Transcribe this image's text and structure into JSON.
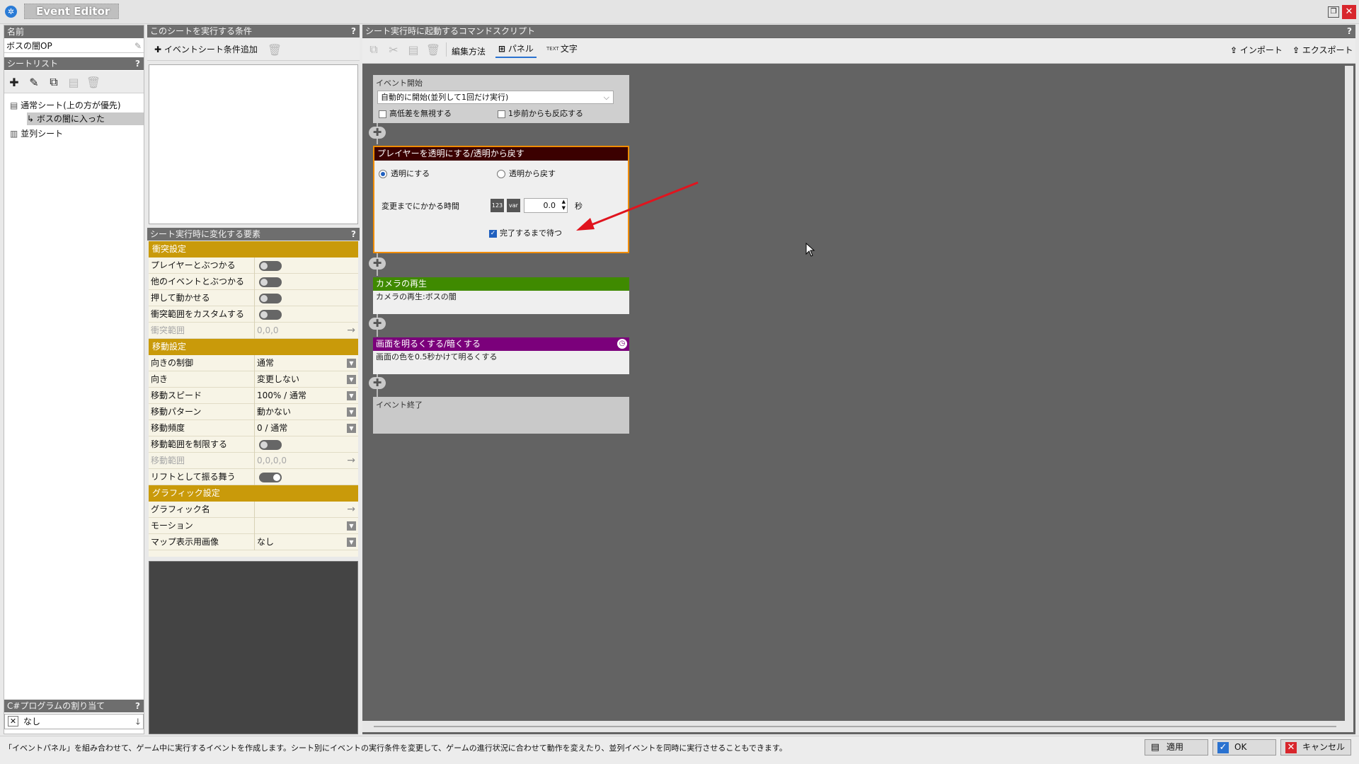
{
  "window": {
    "title": "Event Editor"
  },
  "left": {
    "name_header": "名前",
    "name_value": "ボスの闇OP",
    "sheet_header": "シートリスト",
    "tree": {
      "normal": "通常シート(上の方が優先)",
      "child": "ボスの闇に入った",
      "parallel": "並列シート"
    },
    "csharp_header": "C#プログラムの割り当て",
    "csharp_value": "なし"
  },
  "conditions": {
    "header": "このシートを実行する条件",
    "add_label": "イベントシート条件追加"
  },
  "props": {
    "header": "シート実行時に変化する要素",
    "cat1": "衝突設定",
    "r1": "プレイヤーとぶつかる",
    "r2": "他のイベントとぶつかる",
    "r3": "押して動かせる",
    "r4": "衝突範囲をカスタムする",
    "r5": "衝突範囲",
    "r5v": "0,0,0",
    "cat2": "移動設定",
    "r6": "向きの制御",
    "r6v": "通常",
    "r7": "向き",
    "r7v": "変更しない",
    "r8": "移動スピード",
    "r8v": "100% / 通常",
    "r9": "移動パターン",
    "r9v": "動かない",
    "r10": "移動頻度",
    "r10v": "0 / 通常",
    "r11": "移動範囲を制限する",
    "r12": "移動範囲",
    "r12v": "0,0,0,0",
    "r13": "リフトとして振る舞う",
    "cat3": "グラフィック設定",
    "r14": "グラフィック名",
    "r15": "モーション",
    "r16": "マップ表示用画像",
    "r16v": "なし"
  },
  "script": {
    "header": "シート実行時に起動するコマンドスクリプト",
    "edit_mode": "編集方法",
    "panel_mode": "パネル",
    "text_mode": "文字",
    "text_icon_label": "TEXT",
    "import": "インポート",
    "export": "エクスポート",
    "start": {
      "title": "イベント開始",
      "select": "自動的に開始(並列して1回だけ実行)",
      "c1": "高低差を無視する",
      "c2": "1歩前からも反応する"
    },
    "p1": {
      "title": "プレイヤーを透明にする/透明から戻す",
      "radio1": "透明にする",
      "radio2": "透明から戻す",
      "time_label": "変更までにかかる時間",
      "num_icon": "123",
      "var_icon": "var",
      "time_value": "0.0",
      "unit": "秒",
      "wait": "完了するまで待つ"
    },
    "p2": {
      "title": "カメラの再生",
      "body": "カメラの再生:ボスの闇"
    },
    "p3": {
      "title": "画面を明るくする/暗くする",
      "body": "画面の色を0.5秒かけて明るくする"
    },
    "end": {
      "title": "イベント終了"
    }
  },
  "status": "「イベントパネル」を組み合わせて、ゲーム中に実行するイベントを作成します。シート別にイベントの実行条件を変更して、ゲームの進行状況に合わせて動作を変えたり、並列イベントを同時に実行させることもできます。",
  "buttons": {
    "apply": "適用",
    "ok": "OK",
    "cancel": "キャンセル"
  },
  "colors": {
    "camera_green": "#3f8a00",
    "fade_purple": "#7b007b",
    "transparent_dark": "#3b0000",
    "category_gold": "#c99a0a",
    "arrow_red": "#e0141e"
  }
}
